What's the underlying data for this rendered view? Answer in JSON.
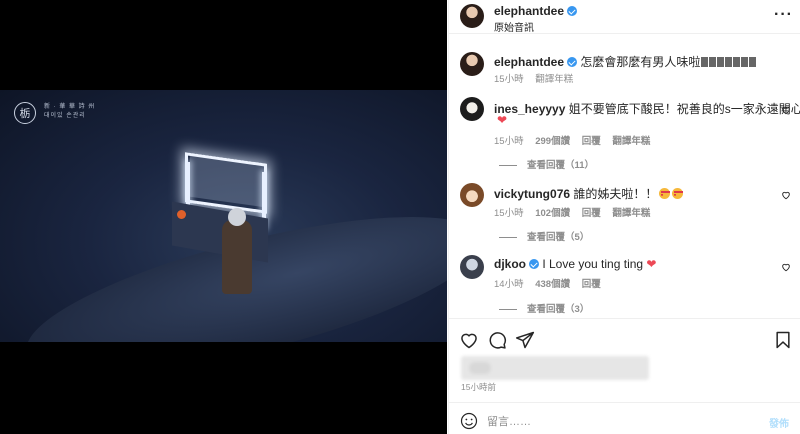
{
  "media": {
    "logo_glyph": "栃",
    "logo_text_line1": "新 · 華 華 詩 州",
    "logo_text_line2": "대이있 손관리"
  },
  "post": {
    "author": "elephantdee",
    "audio": "原始音訊"
  },
  "caption": {
    "username": "elephantdee",
    "text": "怎麼會那麼有男人味啦",
    "time": "15小時",
    "translate": "翻譯年糕"
  },
  "comments": [
    {
      "username": "ines_heyyyy",
      "text": "姐不要管底下酸民！祝善良的s一家永遠開心",
      "time": "15小時",
      "likes": "299個讚",
      "reply": "回覆",
      "translate": "翻譯年糕",
      "view_replies": "查看回覆（11）"
    },
    {
      "username": "vickytung076",
      "text": "誰的姊夫啦！！",
      "time": "15小時",
      "likes": "102個讚",
      "reply": "回覆",
      "translate": "翻譯年糕",
      "view_replies": "查看回覆（5）"
    },
    {
      "username": "djkoo",
      "text": "I Love you ting ting",
      "time": "14小時",
      "likes": "438個讚",
      "reply": "回覆",
      "view_replies": "查看回覆（3）"
    }
  ],
  "footer": {
    "time_ago": "15小時前",
    "comment_placeholder": "留言……",
    "post_label": "發佈"
  },
  "colors": {
    "verified": "#3897f0",
    "heart": "#ed4956",
    "post_disabled": "#b2dffc"
  }
}
